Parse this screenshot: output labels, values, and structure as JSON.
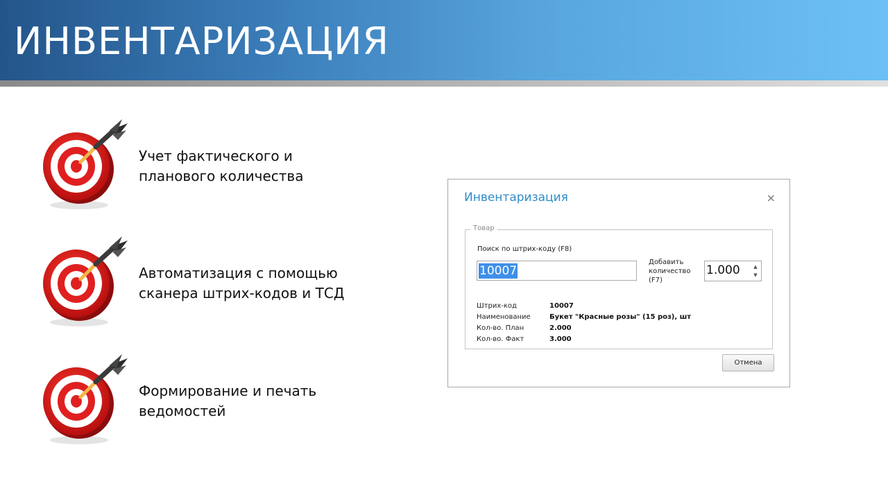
{
  "slide": {
    "title": "ИНВЕНТАРИЗАЦИЯ"
  },
  "features": [
    {
      "icon": "target-dart-icon",
      "line1": "Учет фактического и",
      "line2": "планового количества"
    },
    {
      "icon": "target-dart-icon",
      "line1": "Автоматизация с помощью",
      "line2": "сканера штрих-кодов и ТСД"
    },
    {
      "icon": "target-dart-icon",
      "line1": "Формирование и печать",
      "line2": "ведомостей"
    }
  ],
  "dialog": {
    "title": "Инвентаризация",
    "close_glyph": "×",
    "group_label": "Товар",
    "search_label": "Поиск по штрих-коду (F8)",
    "search_value": "10007",
    "add_label": [
      "Добавить",
      "количество",
      "(F7)"
    ],
    "quantity_value": "1.000",
    "spin_up_glyph": "▲",
    "spin_down_glyph": "▼",
    "details": [
      {
        "label": "Штрих-код",
        "value": "10007"
      },
      {
        "label": "Наименование",
        "value": "Букет \"Красные розы\" (15 роз), шт"
      },
      {
        "label": "Кол-во. План",
        "value": "2.000"
      },
      {
        "label": "Кол-во. Факт",
        "value": "3.000"
      }
    ],
    "cancel_label": "Отмена"
  },
  "colors": {
    "banner_dark": "#24558a",
    "banner_light": "#6cc0f5",
    "dialog_title": "#2e8cc8",
    "selection": "#3f8fe8",
    "target_red": "#e02020"
  }
}
